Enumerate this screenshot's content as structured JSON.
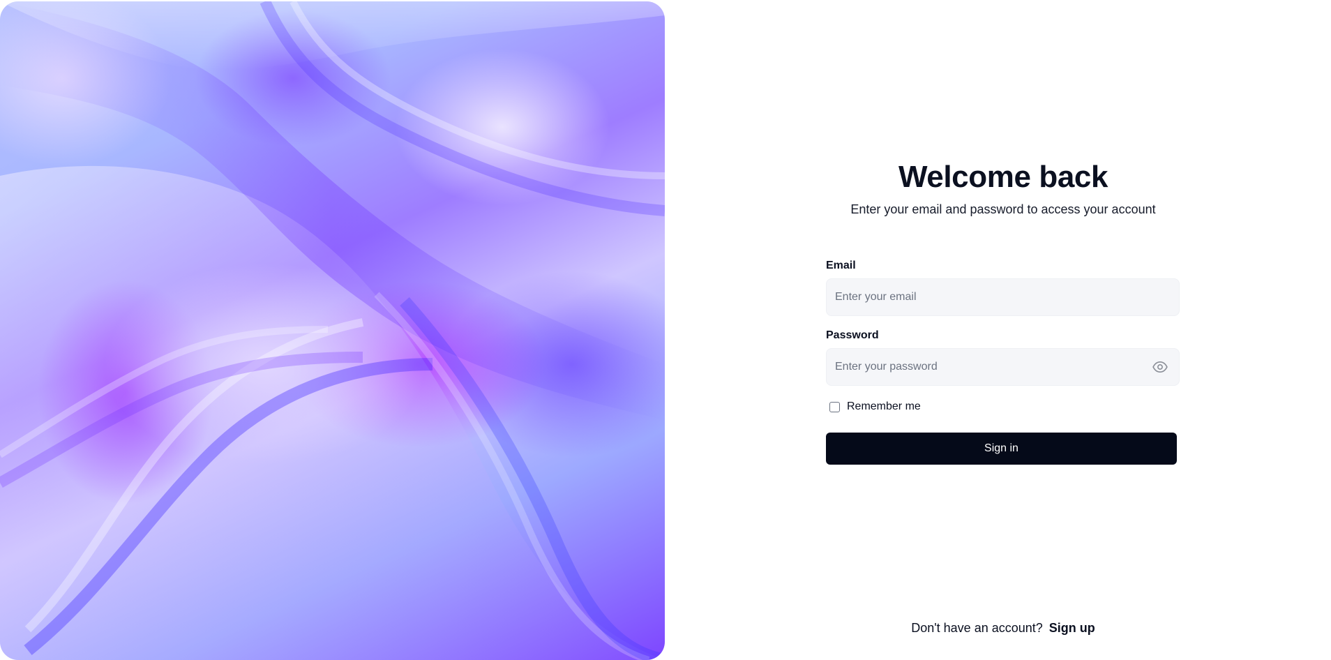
{
  "colors": {
    "accent": "#050a19",
    "input_bg": "#f5f6f9",
    "text": "#0b1020",
    "muted": "#6b7280"
  },
  "hero": {
    "image": "abstract-purple-waves"
  },
  "login": {
    "title": "Welcome back",
    "subtitle": "Enter your email and password to access your account",
    "email_label": "Email",
    "email_placeholder": "Enter your email",
    "password_label": "Password",
    "password_placeholder": "Enter your password",
    "password_toggle_icon": "eye-icon",
    "remember_label": "Remember me",
    "remember_checked": false,
    "signin_label": "Sign in"
  },
  "footer": {
    "prompt": "Don't have an account?",
    "signup_label": "Sign up"
  }
}
